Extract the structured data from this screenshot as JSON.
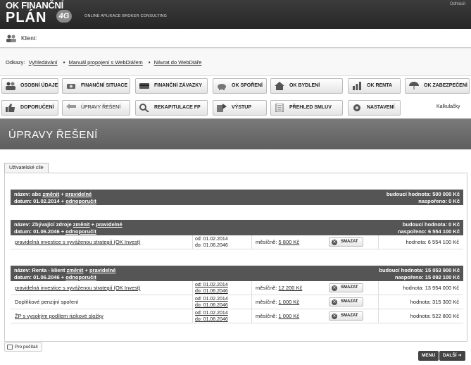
{
  "header": {
    "logo_line1": "OK FINANČNÍ",
    "logo_line2": "PLÁN",
    "logo_badge": "4G",
    "tagline": "ONLINE APLIKACE BROKER CONSULTING",
    "logout": "Odhlásit"
  },
  "client": {
    "label": "Klient:",
    "value": ""
  },
  "links": {
    "label": "Odkazy:",
    "items": [
      "Vyhledávání",
      "Manuál propojení s WebDiářem",
      "Návrat do WebDiáře"
    ]
  },
  "nav": {
    "row1": [
      "OSOBNÍ ÚDAJE",
      "FINANČNÍ SITUACE",
      "FINANČNÍ ZÁVAZKY",
      "OK SPOŘENÍ",
      "OK BYDLENÍ",
      "OK RENTA",
      "OK ZABEZPEČENÍ"
    ],
    "row2": [
      "DOPORUČENÍ",
      "ÚPRAVY ŘEŠENÍ",
      "REKAPITULACE FP",
      "VÝSTUP",
      "PŘEHLED SMLUV",
      "NASTAVENÍ"
    ],
    "calc": "Kalkulačky"
  },
  "page_title": "ÚPRAVY ŘEŠENÍ",
  "tab_label": "Uživatelské cíle",
  "goals": [
    {
      "name_prefix": "název: abc",
      "change": "změnit",
      "type": "pravidelné",
      "date": "datum: 01.02.2014",
      "recommended": "odnoporučit",
      "future_value": "budoucí hodnota: 500 000 Kč",
      "saved": "naspořeno: 0 Kč",
      "rows": []
    },
    {
      "name_prefix": "název: Zbývající zdroje",
      "change": "změnit",
      "type": "pravidelné",
      "date": "datum: 01.06.2046",
      "recommended": "odnoporučit",
      "future_value": "budoucí hodnota: 0 Kč",
      "saved": "naspořeno: 6 554 100 Kč",
      "rows": [
        {
          "product": "pravidelná investice s vyváženou strategií (OK Invest)",
          "from": "od: 01.02.2014",
          "to": "do: 01.06.2046",
          "monthly": "měsíčně:",
          "amount": "5 800 Kč",
          "delete": "SMAZAT",
          "value": "hodnota: 6 554 100 Kč"
        }
      ]
    },
    {
      "name_prefix": "název: Renta - klient",
      "change": "změnit",
      "type": "pravidelné",
      "date": "datum: 01.06.2046",
      "recommended": "odnoporučit",
      "future_value": "budoucí hodnota: 15 053 900 Kč",
      "saved": "naspořeno: 15 092 100 Kč",
      "rows": [
        {
          "product": "pravidelná investice s vyváženou strategií (OK Invest)",
          "from": "od: 01.02.2014",
          "to": "do: 01.06.2046",
          "monthly": "měsíčně:",
          "amount": "12 200 Kč",
          "delete": "SMAZAT",
          "value": "hodnota: 13 954 000 Kč"
        },
        {
          "product": "Doplňkové penzijní spoření",
          "from": "od: 01.02.2014",
          "to": "do: 01.06.2046",
          "monthly": "měsíčně:",
          "amount": "1 000 Kč",
          "delete": "SMAZAT",
          "value": "hodnota: 315 300 Kč"
        },
        {
          "product": "ŽP s vysokým podílem rizikové složky",
          "from": "od: 01.02.2014",
          "to": "do: 01.06.2046",
          "monthly": "měsíčně:",
          "amount": "1 000 Kč",
          "delete": "SMAZAT",
          "value": "hodnota: 522 800 Kč"
        }
      ]
    }
  ],
  "print_label": "Pro počítač",
  "footer_buttons": {
    "menu": "MENU",
    "next": "DALŠÍ ➜"
  }
}
